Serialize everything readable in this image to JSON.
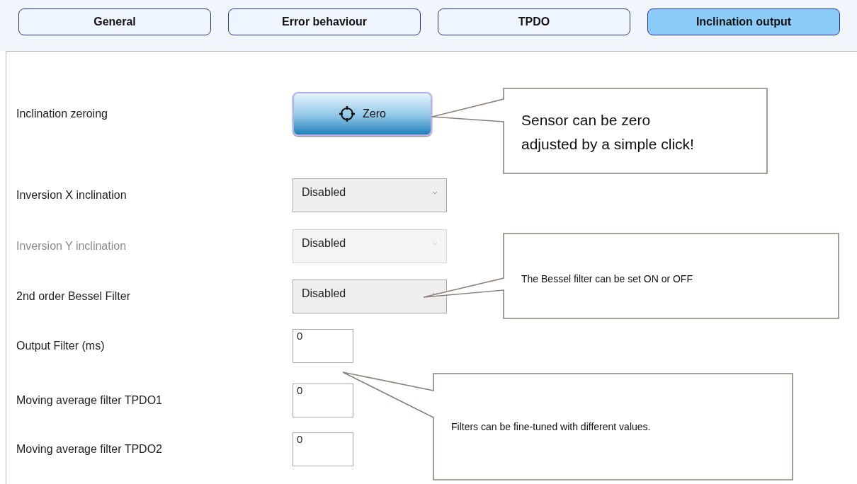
{
  "tabs": [
    {
      "label": "General",
      "selected": false
    },
    {
      "label": "Error behaviour",
      "selected": false
    },
    {
      "label": "TPDO",
      "selected": false
    },
    {
      "label": "Inclination output",
      "selected": true
    }
  ],
  "settings": [
    {
      "label": "Inclination zeroing",
      "kind": "button",
      "value": "Zero",
      "disabled": false
    },
    {
      "label": "Inversion X inclination",
      "kind": "dropdown",
      "value": "Disabled",
      "disabled": false
    },
    {
      "label": "Inversion Y inclination",
      "kind": "dropdown",
      "value": "Disabled",
      "disabled": true
    },
    {
      "label": "2nd order Bessel Filter",
      "kind": "dropdown",
      "value": "Disabled",
      "disabled": false
    },
    {
      "label": "Output Filter (ms)",
      "kind": "field",
      "value": "0",
      "disabled": false
    },
    {
      "label": "Moving average filter TPDO1",
      "kind": "field",
      "value": "0",
      "disabled": false
    },
    {
      "label": "Moving average filter TPDO2",
      "kind": "field",
      "value": "0",
      "disabled": false
    }
  ],
  "callouts": [
    {
      "text": "Sensor can be zero\nadjusted by a simple click!"
    },
    {
      "text": "The Bessel filter can be set ON or OFF"
    },
    {
      "text": "Filters can be fine-tuned with different values."
    }
  ]
}
